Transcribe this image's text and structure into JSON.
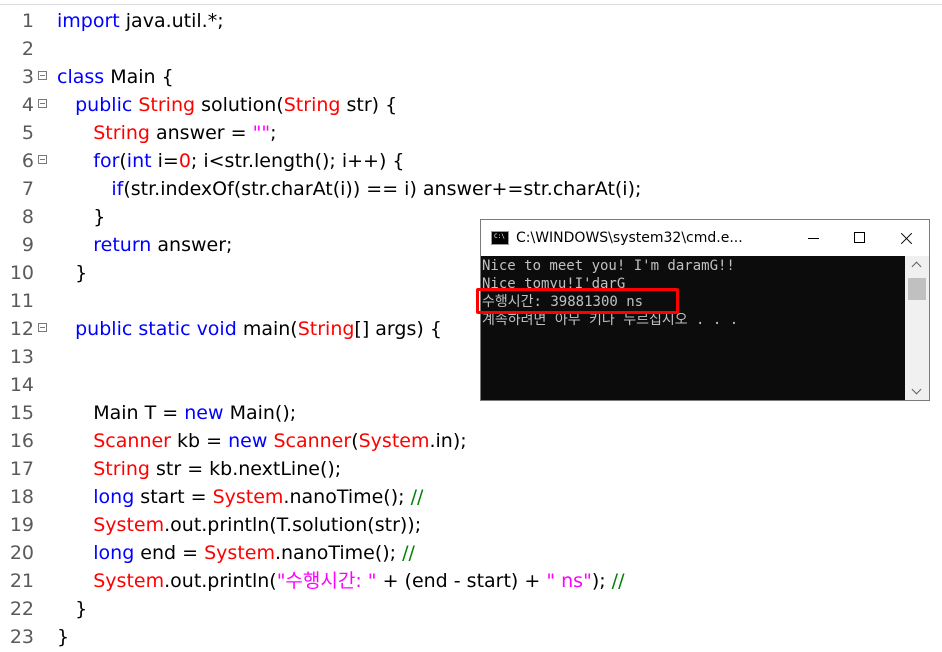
{
  "editor": {
    "lines": [
      {
        "n": "1",
        "fold": false,
        "tokens": [
          [
            "keyword",
            "import"
          ],
          [
            "plain",
            " java.util.*;"
          ]
        ]
      },
      {
        "n": "2",
        "fold": false,
        "tokens": []
      },
      {
        "n": "3",
        "fold": true,
        "tokens": [
          [
            "keyword",
            "class"
          ],
          [
            "plain",
            " Main {"
          ]
        ]
      },
      {
        "n": "4",
        "fold": true,
        "tokens": [
          [
            "plain",
            "   "
          ],
          [
            "keyword",
            "public"
          ],
          [
            "plain",
            " "
          ],
          [
            "type",
            "String"
          ],
          [
            "plain",
            " solution("
          ],
          [
            "type",
            "String"
          ],
          [
            "plain",
            " str) {"
          ]
        ]
      },
      {
        "n": "5",
        "fold": false,
        "tokens": [
          [
            "plain",
            "      "
          ],
          [
            "type",
            "String"
          ],
          [
            "plain",
            " answer = "
          ],
          [
            "string",
            "\"\""
          ],
          [
            "plain",
            ";"
          ]
        ]
      },
      {
        "n": "6",
        "fold": true,
        "tokens": [
          [
            "plain",
            "      "
          ],
          [
            "keyword",
            "for"
          ],
          [
            "plain",
            "("
          ],
          [
            "keyword",
            "int"
          ],
          [
            "plain",
            " i="
          ],
          [
            "number",
            "0"
          ],
          [
            "plain",
            "; i<str.length(); i++) {"
          ]
        ]
      },
      {
        "n": "7",
        "fold": false,
        "tokens": [
          [
            "plain",
            "         "
          ],
          [
            "keyword",
            "if"
          ],
          [
            "plain",
            "(str.indexOf(str.charAt(i)) == i) answer+=str.charAt(i);"
          ]
        ]
      },
      {
        "n": "8",
        "fold": false,
        "tokens": [
          [
            "plain",
            "      }"
          ]
        ]
      },
      {
        "n": "9",
        "fold": false,
        "tokens": [
          [
            "plain",
            "      "
          ],
          [
            "keyword",
            "return"
          ],
          [
            "plain",
            " answer;"
          ]
        ]
      },
      {
        "n": "10",
        "fold": false,
        "tokens": [
          [
            "plain",
            "   }"
          ]
        ]
      },
      {
        "n": "11",
        "fold": false,
        "tokens": []
      },
      {
        "n": "12",
        "fold": true,
        "tokens": [
          [
            "plain",
            "   "
          ],
          [
            "keyword",
            "public"
          ],
          [
            "plain",
            " "
          ],
          [
            "keyword",
            "static"
          ],
          [
            "plain",
            " "
          ],
          [
            "keyword",
            "void"
          ],
          [
            "plain",
            " main("
          ],
          [
            "type",
            "String"
          ],
          [
            "plain",
            "[] args) {"
          ]
        ]
      },
      {
        "n": "13",
        "fold": false,
        "tokens": []
      },
      {
        "n": "14",
        "fold": false,
        "tokens": []
      },
      {
        "n": "15",
        "fold": false,
        "tokens": [
          [
            "plain",
            "      Main T = "
          ],
          [
            "keyword",
            "new"
          ],
          [
            "plain",
            " Main();"
          ]
        ]
      },
      {
        "n": "16",
        "fold": false,
        "tokens": [
          [
            "plain",
            "      "
          ],
          [
            "type",
            "Scanner"
          ],
          [
            "plain",
            " kb = "
          ],
          [
            "keyword",
            "new"
          ],
          [
            "plain",
            " "
          ],
          [
            "type",
            "Scanner"
          ],
          [
            "plain",
            "("
          ],
          [
            "type",
            "System"
          ],
          [
            "plain",
            ".in);"
          ]
        ]
      },
      {
        "n": "17",
        "fold": false,
        "tokens": [
          [
            "plain",
            "      "
          ],
          [
            "type",
            "String"
          ],
          [
            "plain",
            " str = kb.nextLine();"
          ]
        ]
      },
      {
        "n": "18",
        "fold": false,
        "tokens": [
          [
            "plain",
            "      "
          ],
          [
            "keyword",
            "long"
          ],
          [
            "plain",
            " start = "
          ],
          [
            "type",
            "System"
          ],
          [
            "plain",
            ".nanoTime(); "
          ],
          [
            "comment",
            "//"
          ]
        ]
      },
      {
        "n": "19",
        "fold": false,
        "tokens": [
          [
            "plain",
            "      "
          ],
          [
            "type",
            "System"
          ],
          [
            "plain",
            ".out.println(T.solution(str));"
          ]
        ]
      },
      {
        "n": "20",
        "fold": false,
        "tokens": [
          [
            "plain",
            "      "
          ],
          [
            "keyword",
            "long"
          ],
          [
            "plain",
            " end = "
          ],
          [
            "type",
            "System"
          ],
          [
            "plain",
            ".nanoTime(); "
          ],
          [
            "comment",
            "//"
          ]
        ]
      },
      {
        "n": "21",
        "fold": false,
        "tokens": [
          [
            "plain",
            "      "
          ],
          [
            "type",
            "System"
          ],
          [
            "plain",
            ".out.println("
          ],
          [
            "string",
            "\"수행시간: \""
          ],
          [
            "plain",
            " + (end - start) + "
          ],
          [
            "string",
            "\" ns\""
          ],
          [
            "plain",
            "); "
          ],
          [
            "comment",
            "//"
          ]
        ]
      },
      {
        "n": "22",
        "fold": false,
        "tokens": [
          [
            "plain",
            "   }"
          ]
        ]
      },
      {
        "n": "23",
        "fold": false,
        "tokens": [
          [
            "plain",
            "}"
          ]
        ]
      }
    ]
  },
  "cmd": {
    "title": "C:\\WINDOWS\\system32\\cmd.e...",
    "output": [
      "Nice to meet you! I'm daramG!!",
      "Nice tomyu!I'darG",
      "수행시간: 39881300 ns",
      "계속하려면 아무 키나 누르십시오 . . ."
    ]
  }
}
